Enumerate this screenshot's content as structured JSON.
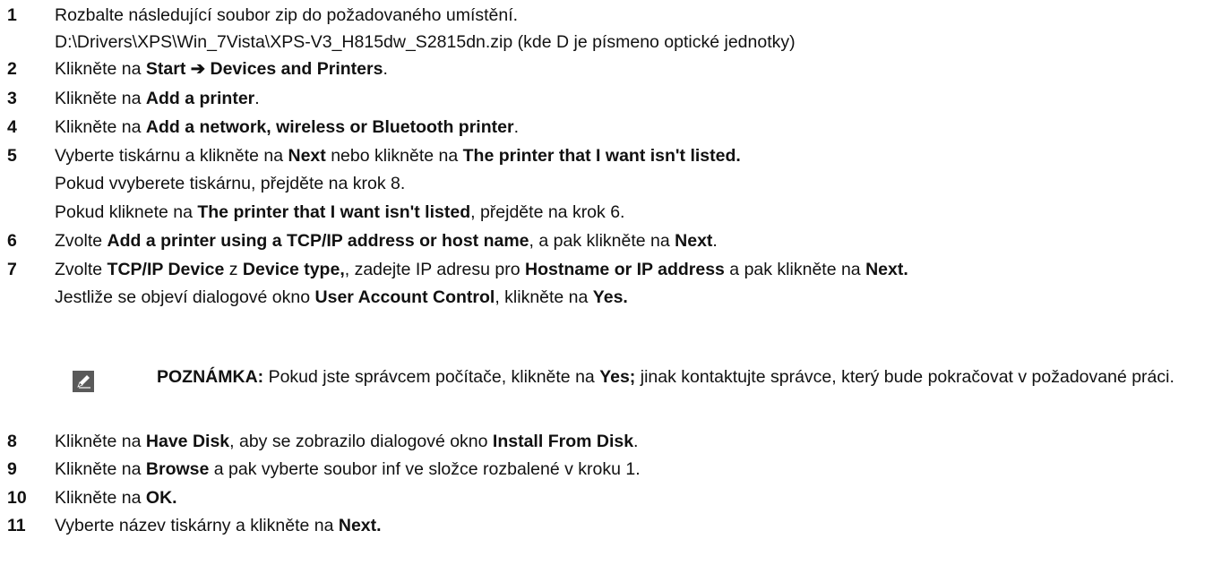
{
  "steps": [
    {
      "num": "1",
      "parts": [
        {
          "t": "Rozbalte následující soubor zip do požadovaného umístění.",
          "b": false
        }
      ]
    },
    {
      "num": "",
      "parts": [
        {
          "t": "D:\\Drivers\\XPS\\Win_7Vista\\XPS-V3_H815dw_S2815dn.zip (kde D je písmeno optické jednotky)",
          "b": false
        }
      ]
    },
    {
      "num": "2",
      "parts": [
        {
          "t": "Klikněte na ",
          "b": false
        },
        {
          "t": "Start ➔ Devices and Printers",
          "b": true
        },
        {
          "t": ".",
          "b": false
        }
      ]
    },
    {
      "num": "3",
      "parts": [
        {
          "t": "Klikněte na ",
          "b": false
        },
        {
          "t": "Add a printer",
          "b": true
        },
        {
          "t": ".",
          "b": false
        }
      ]
    },
    {
      "num": "4",
      "parts": [
        {
          "t": "Klikněte na ",
          "b": false
        },
        {
          "t": "Add a network, wireless or Bluetooth printer",
          "b": true
        },
        {
          "t": ".",
          "b": false
        }
      ]
    },
    {
      "num": "5",
      "parts": [
        {
          "t": "Vyberte tiskárnu a klikněte na ",
          "b": false
        },
        {
          "t": "Next",
          "b": true
        },
        {
          "t": " nebo klikněte na ",
          "b": false
        },
        {
          "t": "The printer that I want isn't listed.",
          "b": true
        }
      ]
    },
    {
      "num": "",
      "parts": [
        {
          "t": "Pokud vvyberete tiskárnu, přejděte na krok 8.",
          "b": false
        }
      ]
    },
    {
      "num": "",
      "parts": [
        {
          "t": "Pokud kliknete na ",
          "b": false
        },
        {
          "t": "The printer that I want isn't listed",
          "b": true
        },
        {
          "t": ", přejděte na krok 6.",
          "b": false
        }
      ]
    },
    {
      "num": "6",
      "parts": [
        {
          "t": "Zvolte ",
          "b": false
        },
        {
          "t": "Add a printer using a TCP/IP address or host name",
          "b": true
        },
        {
          "t": ", a pak klikněte na ",
          "b": false
        },
        {
          "t": "Next",
          "b": true
        },
        {
          "t": ".",
          "b": false
        }
      ]
    },
    {
      "num": "7",
      "parts": [
        {
          "t": "Zvolte ",
          "b": false
        },
        {
          "t": "TCP/IP Device",
          "b": true
        },
        {
          "t": " z ",
          "b": false
        },
        {
          "t": "Device type,",
          "b": true
        },
        {
          "t": ", zadejte IP adresu pro ",
          "b": false
        },
        {
          "t": "Hostname or IP address",
          "b": true
        },
        {
          "t": " a pak klikněte na ",
          "b": false
        },
        {
          "t": "Next.",
          "b": true
        }
      ]
    },
    {
      "num": "",
      "parts": [
        {
          "t": "Jestliže se objeví dialogové okno ",
          "b": false
        },
        {
          "t": "User Account Control",
          "b": true
        },
        {
          "t": ", klikněte na ",
          "b": false
        },
        {
          "t": "Yes.",
          "b": true
        }
      ]
    }
  ],
  "note": {
    "icon": "pencil-note-icon",
    "label": "POZNÁMKA:",
    "parts": [
      {
        "t": " Pokud jste správcem počítače, klikněte na ",
        "b": false
      },
      {
        "t": "Yes;",
        "b": true
      },
      {
        "t": " jinak kontaktujte správce, který bude pokračovat v požadované práci.",
        "b": false
      }
    ]
  },
  "steps_after": [
    {
      "num": "8",
      "parts": [
        {
          "t": "Klikněte na ",
          "b": false
        },
        {
          "t": "Have Disk",
          "b": true
        },
        {
          "t": ", aby se zobrazilo dialogové okno ",
          "b": false
        },
        {
          "t": "Install From Disk",
          "b": true
        },
        {
          "t": ".",
          "b": false
        }
      ]
    },
    {
      "num": "9",
      "parts": [
        {
          "t": "Klikněte na ",
          "b": false
        },
        {
          "t": "Browse",
          "b": true
        },
        {
          "t": " a pak vyberte soubor inf ve složce rozbalené v kroku 1.",
          "b": false
        }
      ]
    },
    {
      "num": "10",
      "parts": [
        {
          "t": "Klikněte na ",
          "b": false
        },
        {
          "t": "OK.",
          "b": true
        }
      ]
    },
    {
      "num": "11",
      "parts": [
        {
          "t": "Vyberte název tiskárny a klikněte na ",
          "b": false
        },
        {
          "t": "Next.",
          "b": true
        }
      ]
    }
  ]
}
